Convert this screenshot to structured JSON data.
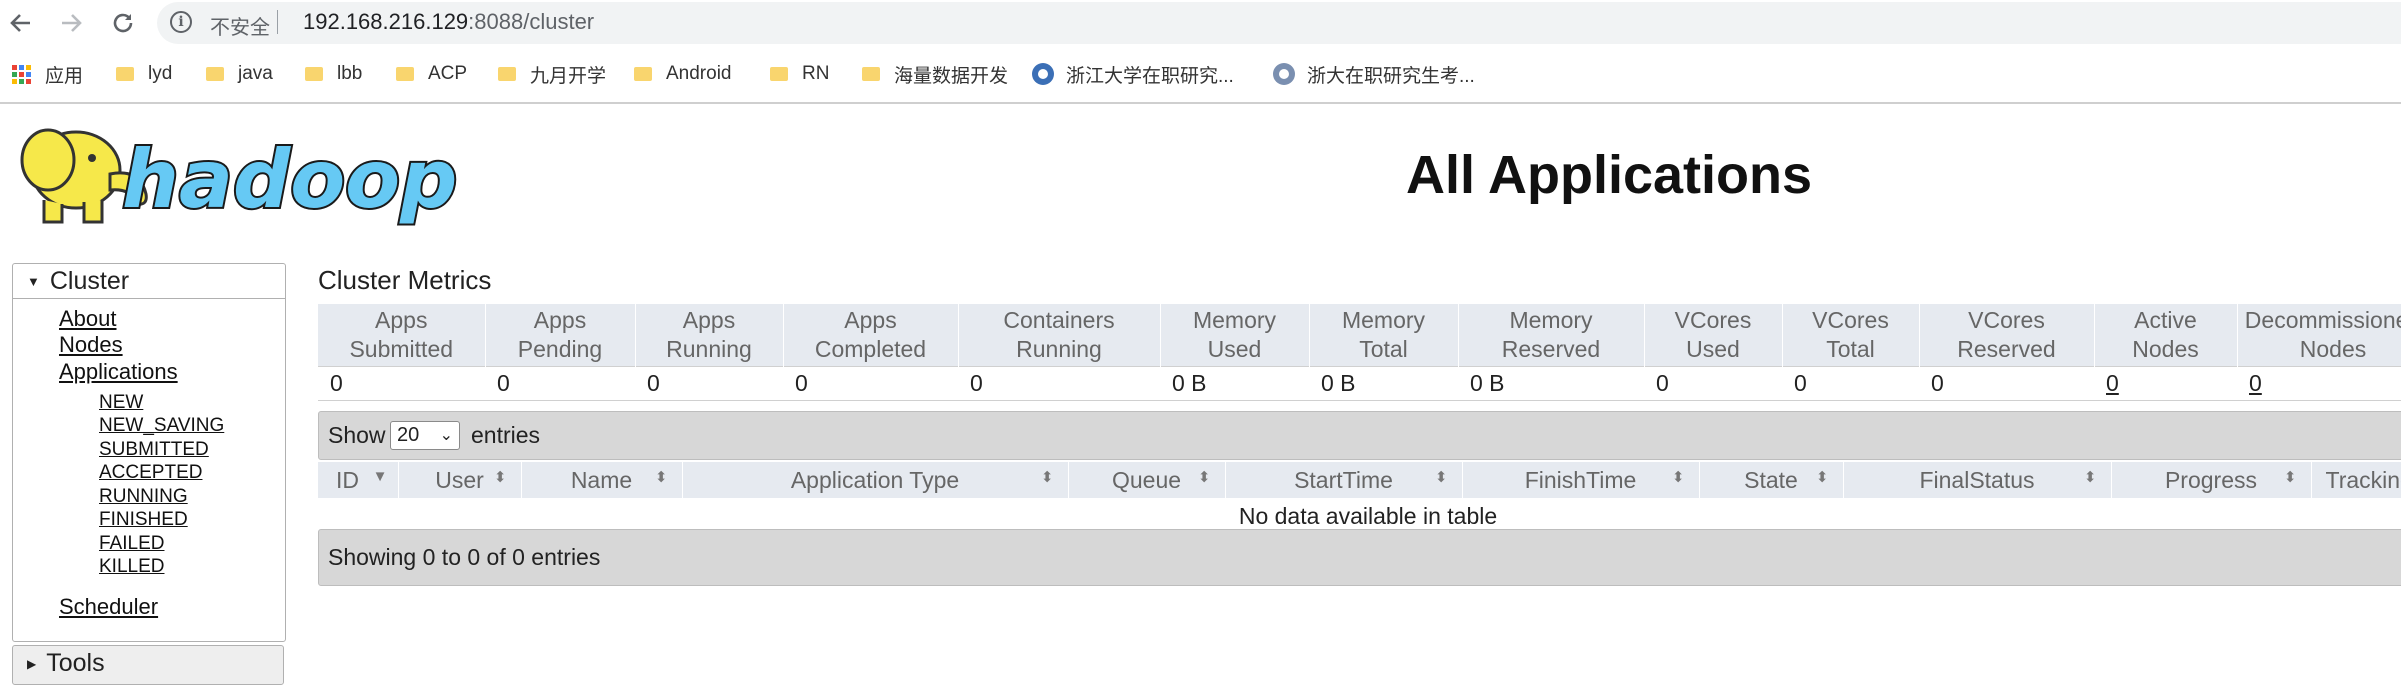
{
  "browser": {
    "security_text": "不安全",
    "url_host": "192.168.216.129",
    "url_rest": ":8088/cluster",
    "bookmarks": [
      "应用",
      "lyd",
      "java",
      "lbb",
      "ACP",
      "九月开学",
      "Android",
      "RN",
      "海量数据开发",
      "浙江大学在职研究...",
      "浙大在职研究生考..."
    ]
  },
  "header": {
    "title": "All Applications",
    "logo_text": "hadoop"
  },
  "sidebar": {
    "cluster_label": "Cluster",
    "links": [
      "About",
      "Nodes",
      "Applications"
    ],
    "states": [
      "NEW",
      "NEW_SAVING",
      "SUBMITTED",
      "ACCEPTED",
      "RUNNING",
      "FINISHED",
      "FAILED",
      "KILLED"
    ],
    "scheduler_label": "Scheduler",
    "tools_label": "Tools"
  },
  "metrics": {
    "caption": "Cluster Metrics",
    "headers": [
      [
        "Apps",
        "Submitted"
      ],
      [
        "Apps",
        "Pending"
      ],
      [
        "Apps",
        "Running"
      ],
      [
        "Apps",
        "Completed"
      ],
      [
        "Containers",
        "Running"
      ],
      [
        "Memory",
        "Used"
      ],
      [
        "Memory",
        "Total"
      ],
      [
        "Memory",
        "Reserved"
      ],
      [
        "VCores",
        "Used"
      ],
      [
        "VCores",
        "Total"
      ],
      [
        "VCores",
        "Reserved"
      ],
      [
        "Active",
        "Nodes"
      ],
      [
        "Decommissioned",
        "Nodes"
      ]
    ],
    "values": [
      "0",
      "0",
      "0",
      "0",
      "0",
      "0 B",
      "0 B",
      "0 B",
      "0",
      "0",
      "0",
      "0",
      "0"
    ]
  },
  "apps_table": {
    "show_label": "Show",
    "page_length": "20",
    "entries_label": "entries",
    "columns": [
      "ID",
      "User",
      "Name",
      "Application Type",
      "Queue",
      "StartTime",
      "FinishTime",
      "State",
      "FinalStatus",
      "Progress",
      "Tracking UI"
    ],
    "empty_message": "No data available in table",
    "info": "Showing 0 to 0 of 0 entries"
  },
  "colors": {
    "header_bg": "#e6eaf0",
    "toolbar_bg": "#d7d7d7",
    "logo_yellow": "#f6e84a",
    "logo_blue": "#66c9f4"
  }
}
